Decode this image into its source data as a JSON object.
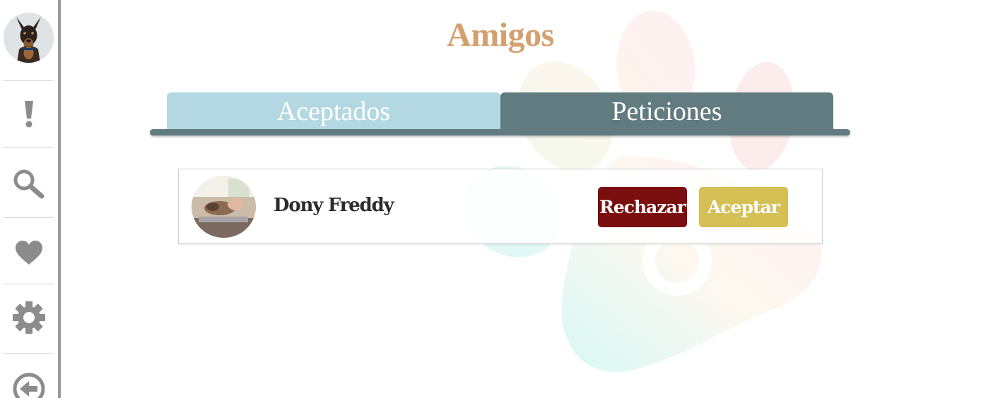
{
  "page": {
    "title": "Amigos"
  },
  "sidebar": {
    "items": [
      {
        "name": "notifications",
        "icon": "exclamation-icon"
      },
      {
        "name": "search",
        "icon": "search-icon"
      },
      {
        "name": "favorites",
        "icon": "heart-icon"
      },
      {
        "name": "settings",
        "icon": "gear-icon"
      },
      {
        "name": "logout",
        "icon": "logout-arrow-icon"
      }
    ],
    "icon_color": "#8c8c8c"
  },
  "tabs": {
    "accepted_label": "Aceptados",
    "requests_label": "Peticiones",
    "active": "Peticiones"
  },
  "requests": [
    {
      "name": "Dony Freddy",
      "reject_label": "Rechazar",
      "accept_label": "Aceptar"
    }
  ],
  "colors": {
    "title": "#d3a16f",
    "tab_inactive": "#b1d7e0",
    "tab_active": "#627b80",
    "reject": "#7a0e0e",
    "accept": "#d4c055"
  }
}
